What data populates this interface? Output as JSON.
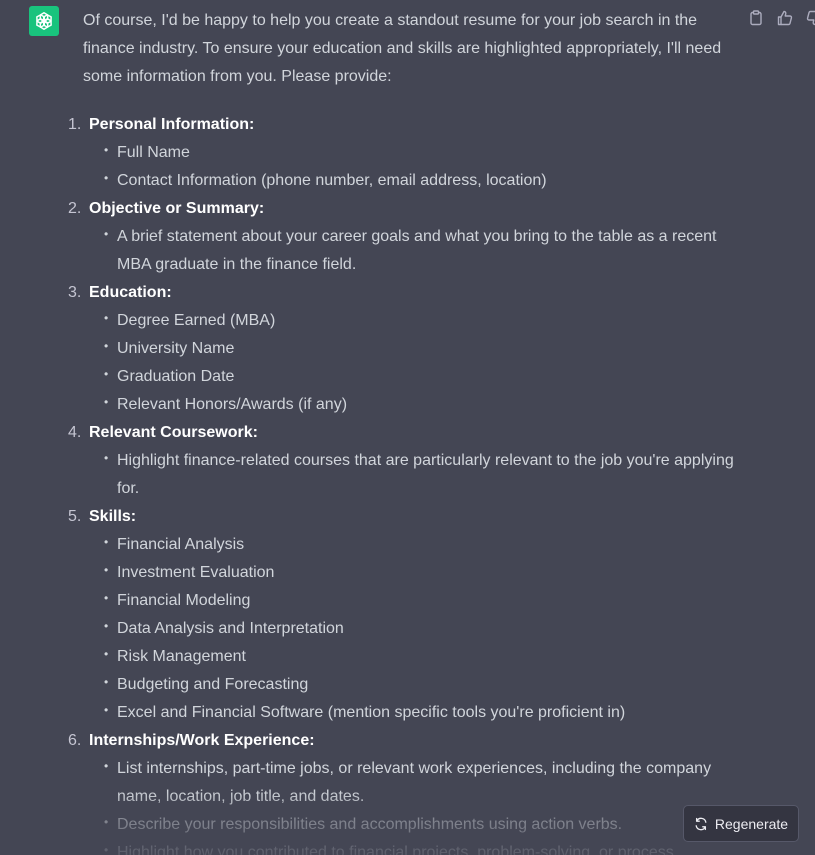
{
  "avatar": {
    "icon": "openai-logo-icon",
    "color": "#19c37d"
  },
  "actions": [
    {
      "icon": "copy-icon"
    },
    {
      "icon": "thumbs-up-icon"
    },
    {
      "icon": "thumbs-down-icon"
    }
  ],
  "message": {
    "intro": "Of course, I'd be happy to help you create a standout resume for your job search in the finance industry. To ensure your education and skills are highlighted appropriately, I'll need some information from you. Please provide:",
    "steps": [
      {
        "num": "1.",
        "title": "Personal Information:",
        "items": [
          "Full Name",
          "Contact Information (phone number, email address, location)"
        ]
      },
      {
        "num": "2.",
        "title": "Objective or Summary:",
        "items": [
          "A brief statement about your career goals and what you bring to the table as a recent MBA graduate in the finance field."
        ]
      },
      {
        "num": "3.",
        "title": "Education:",
        "items": [
          "Degree Earned (MBA)",
          "University Name",
          "Graduation Date",
          "Relevant Honors/Awards (if any)"
        ]
      },
      {
        "num": "4.",
        "title": "Relevant Coursework:",
        "items": [
          "Highlight finance-related courses that are particularly relevant to the job you're applying for."
        ]
      },
      {
        "num": "5.",
        "title": "Skills:",
        "items": [
          "Financial Analysis",
          "Investment Evaluation",
          "Financial Modeling",
          "Data Analysis and Interpretation",
          "Risk Management",
          "Budgeting and Forecasting",
          "Excel and Financial Software (mention specific tools you're proficient in)"
        ]
      },
      {
        "num": "6.",
        "title": "Internships/Work Experience:",
        "items": [
          "List internships, part-time jobs, or relevant work experiences, including the company name, location, job title, and dates.",
          "Describe your responsibilities and accomplishments using action verbs.",
          "Highlight how you contributed to financial projects, problem-solving, or process"
        ]
      }
    ]
  },
  "regenerate": {
    "label": "Regenerate",
    "icon": "refresh-icon"
  }
}
